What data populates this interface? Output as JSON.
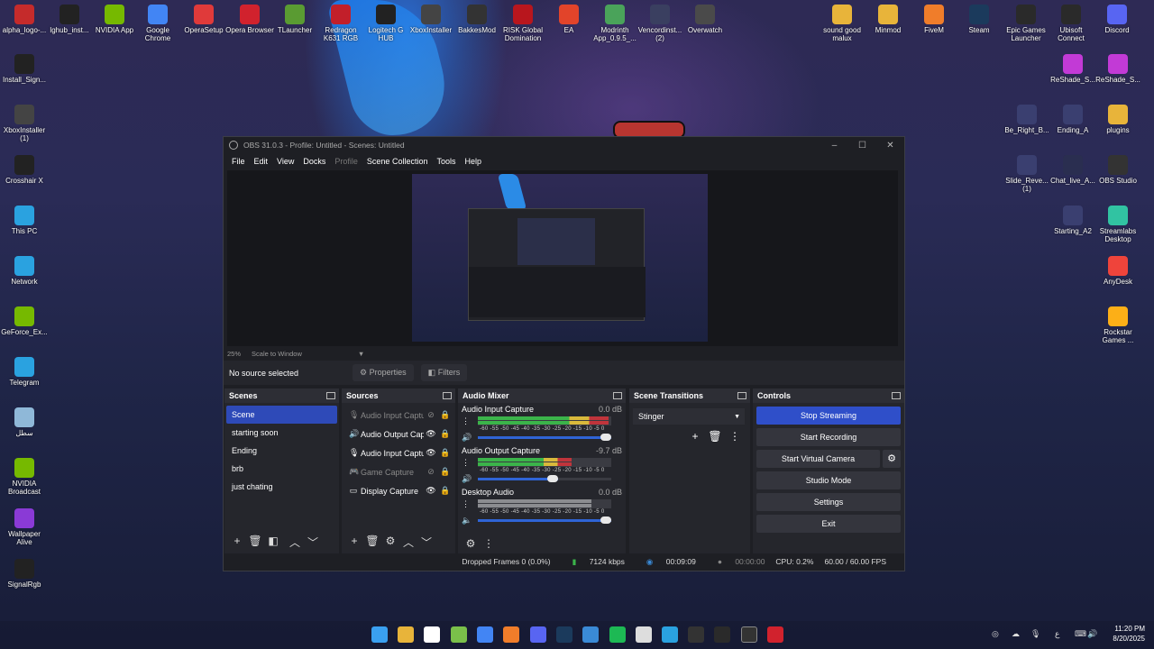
{
  "desktop": {
    "top_icons": [
      {
        "label": "alpha_logo-...",
        "icon": "alpha-logo-icon",
        "color": "#c52b2b"
      },
      {
        "label": "lghub_inst...",
        "icon": "logitech-g-icon",
        "color": "#222222"
      },
      {
        "label": "NVIDIA App",
        "icon": "nvidia-icon",
        "color": "#76b900"
      },
      {
        "label": "Google Chrome",
        "icon": "chrome-icon",
        "color": "#4285f4"
      },
      {
        "label": "OperaSetup",
        "icon": "opera-setup-icon",
        "color": "#e03a3a"
      },
      {
        "label": "Opera Browser",
        "icon": "opera-icon",
        "color": "#d1222d"
      },
      {
        "label": "TLauncher",
        "icon": "tlauncher-icon",
        "color": "#5a9b32"
      },
      {
        "label": "Redragon K631 RGB",
        "icon": "redragon-icon",
        "color": "#c21f2a"
      },
      {
        "label": "Logitech G HUB",
        "icon": "logitech-ghub-icon",
        "color": "#222222"
      },
      {
        "label": "XboxInstaller",
        "icon": "xbox-icon",
        "color": "#444444"
      },
      {
        "label": "BakkesMod",
        "icon": "bakkesmod-icon",
        "color": "#333333"
      },
      {
        "label": "RISK Global Domination",
        "icon": "risk-icon",
        "color": "#b8161d"
      },
      {
        "label": "EA",
        "icon": "ea-icon",
        "color": "#e2442a"
      },
      {
        "label": "Modrinth App_0.9.5_...",
        "icon": "modrinth-icon",
        "color": "#4aa35a"
      },
      {
        "label": "Vencordinst... (2)",
        "icon": "vencord-icon",
        "color": "#3a3f60"
      },
      {
        "label": "Overwatch",
        "icon": "overwatch-icon",
        "color": "#4a4a4a"
      },
      {
        "label": "sound good malux",
        "icon": "folder-icon",
        "color": "#e8b43a"
      },
      {
        "label": "Minmod",
        "icon": "folder-icon",
        "color": "#e8b43a"
      },
      {
        "label": "FiveM",
        "icon": "fivem-icon",
        "color": "#f07d2a"
      },
      {
        "label": "Steam",
        "icon": "steam-icon",
        "color": "#1b3a5c"
      },
      {
        "label": "Epic Games Launcher",
        "icon": "epic-games-icon",
        "color": "#2a2a2a"
      },
      {
        "label": "Ubisoft Connect",
        "icon": "ubisoft-icon",
        "color": "#2a2a2a"
      },
      {
        "label": "Discord",
        "icon": "discord-icon",
        "color": "#5865f2"
      }
    ],
    "left_icons": [
      {
        "label": "Install_Sign...",
        "icon": "signalrgb-installer-icon",
        "color": "#222222"
      },
      {
        "label": "XboxInstaller (1)",
        "icon": "xbox-icon",
        "color": "#444444"
      },
      {
        "label": "Crosshair X",
        "icon": "crosshair-icon",
        "color": "#222222"
      },
      {
        "label": "This PC",
        "icon": "pc-icon",
        "color": "#2aa2e0"
      },
      {
        "label": "Network",
        "icon": "network-icon",
        "color": "#2aa2e0"
      },
      {
        "label": "GeForce_Ex...",
        "icon": "geforce-icon",
        "color": "#76b900"
      },
      {
        "label": "Telegram",
        "icon": "telegram-icon",
        "color": "#2aa2e0"
      },
      {
        "label": "سطل",
        "icon": "recycle-bin-icon",
        "color": "#8fb8d8"
      },
      {
        "label": "NVIDIA Broadcast",
        "icon": "nvidia-broadcast-icon",
        "color": "#76b900"
      },
      {
        "label": "Wallpaper Alive",
        "icon": "wallpaper-alive-icon",
        "color": "#8a3ad6"
      },
      {
        "label": "SignalRgb",
        "icon": "signalrgb-icon",
        "color": "#222222"
      }
    ],
    "right_icons": [
      {
        "label": "ReShade_S...",
        "icon": "reshade-icon",
        "color": "#c23ad6"
      },
      {
        "label": "ReShade_S...",
        "icon": "reshade-icon",
        "color": "#c23ad6"
      },
      {
        "label": "Be_Right_B...",
        "icon": "video-file-icon",
        "color": "#3a3f70"
      },
      {
        "label": "Ending_A",
        "icon": "video-file-icon",
        "color": "#3a3f70"
      },
      {
        "label": "plugins",
        "icon": "folder-icon",
        "color": "#e8b43a"
      },
      {
        "label": "Slide_Reve... (1)",
        "icon": "video-file-icon",
        "color": "#3a3f70"
      },
      {
        "label": "Chat_live_A...",
        "icon": "file-icon",
        "color": "#2a2e50"
      },
      {
        "label": "OBS Studio",
        "icon": "obs-icon",
        "color": "#333333"
      },
      {
        "label": "Starting_A2",
        "icon": "video-file-icon",
        "color": "#3a3f70"
      },
      {
        "label": "Streamlabs Desktop",
        "icon": "streamlabs-icon",
        "color": "#31c3a2"
      },
      {
        "label": "AnyDesk",
        "icon": "anydesk-icon",
        "color": "#ef443b"
      },
      {
        "label": "Rockstar Games ...",
        "icon": "rockstar-icon",
        "color": "#fcaf17"
      }
    ]
  },
  "obs": {
    "title": "OBS 31.0.3 - Profile: Untitled - Scenes: Untitled",
    "menu": [
      {
        "label": "File",
        "disabled": false
      },
      {
        "label": "Edit",
        "disabled": false
      },
      {
        "label": "View",
        "disabled": false
      },
      {
        "label": "Docks",
        "disabled": false
      },
      {
        "label": "Profile",
        "disabled": true
      },
      {
        "label": "Scene Collection",
        "disabled": false
      },
      {
        "label": "Tools",
        "disabled": false
      },
      {
        "label": "Help",
        "disabled": false
      }
    ],
    "zoom": "25%",
    "scale_mode": "Scale to Window",
    "no_source": "No source selected",
    "properties_label": "Properties",
    "filters_label": "Filters",
    "scenes": {
      "title": "Scenes",
      "items": [
        "Scene",
        "starting soon",
        "Ending",
        "brb",
        "just chating"
      ],
      "selected": 0
    },
    "sources": {
      "title": "Sources",
      "items": [
        {
          "label": "Audio Input Capture",
          "icon": "microphone-icon",
          "visible": false
        },
        {
          "label": "Audio Output Capture",
          "icon": "speaker-icon",
          "visible": true
        },
        {
          "label": "Audio Input Capture",
          "icon": "microphone-icon",
          "visible": true
        },
        {
          "label": "Game Capture",
          "icon": "gamepad-icon",
          "visible": false
        },
        {
          "label": "Display Capture",
          "icon": "monitor-icon",
          "visible": true
        }
      ]
    },
    "mixer": {
      "title": "Audio Mixer",
      "ticks": "-60 -55 -50 -45 -40 -35 -30 -25 -20 -15 -10 -5 0",
      "channels": [
        {
          "name": "Audio Input Capture",
          "db": "0.0 dB",
          "level": 1.0,
          "meter": 0.98,
          "muted": false
        },
        {
          "name": "Audio Output Capture",
          "db": "-9.7 dB",
          "level": 0.6,
          "meter": 0.7,
          "muted": false
        },
        {
          "name": "Desktop Audio",
          "db": "0.0 dB",
          "level": 1.0,
          "meter": 0.85,
          "muted": true
        }
      ]
    },
    "transitions": {
      "title": "Scene Transitions",
      "selected": "Stinger"
    },
    "controls": {
      "title": "Controls",
      "stop_streaming": "Stop Streaming",
      "start_recording": "Start Recording",
      "start_virtual_camera": "Start Virtual Camera",
      "studio_mode": "Studio Mode",
      "settings": "Settings",
      "exit": "Exit"
    },
    "status": {
      "dropped_frames": "Dropped Frames 0 (0.0%)",
      "bitrate": "7124 kbps",
      "stream_time": "00:09:09",
      "record_time": "00:00:00",
      "cpu": "CPU: 0.2%",
      "fps": "60.00 / 60.00 FPS"
    }
  },
  "taskbar": {
    "apps": [
      {
        "icon": "windows-start-icon",
        "color": "#3aa0f0"
      },
      {
        "icon": "file-explorer-icon",
        "color": "#e8b43a"
      },
      {
        "icon": "store-icon",
        "color": "#ffffff"
      },
      {
        "icon": "vectorworks-icon",
        "color": "#7ac04a"
      },
      {
        "icon": "chrome-icon",
        "color": "#4285f4"
      },
      {
        "icon": "fivem-icon",
        "color": "#f07d2a"
      },
      {
        "icon": "discord-icon",
        "color": "#5865f2"
      },
      {
        "icon": "steam-icon",
        "color": "#1b3a5c"
      },
      {
        "icon": "shield-icon",
        "color": "#3a8ad6"
      },
      {
        "icon": "spotify-icon",
        "color": "#1db954"
      },
      {
        "icon": "settings-icon",
        "color": "#dddddd"
      },
      {
        "icon": "telegram-icon",
        "color": "#2aa2e0"
      },
      {
        "icon": "bakkesmod-icon",
        "color": "#333333"
      },
      {
        "icon": "epic-games-icon",
        "color": "#2a2a2a"
      },
      {
        "icon": "obs-icon",
        "color": "#333333"
      },
      {
        "icon": "opera-icon",
        "color": "#d1222d"
      }
    ],
    "lang": "ع",
    "time": "11:20 PM",
    "date": "8/20/2025"
  }
}
